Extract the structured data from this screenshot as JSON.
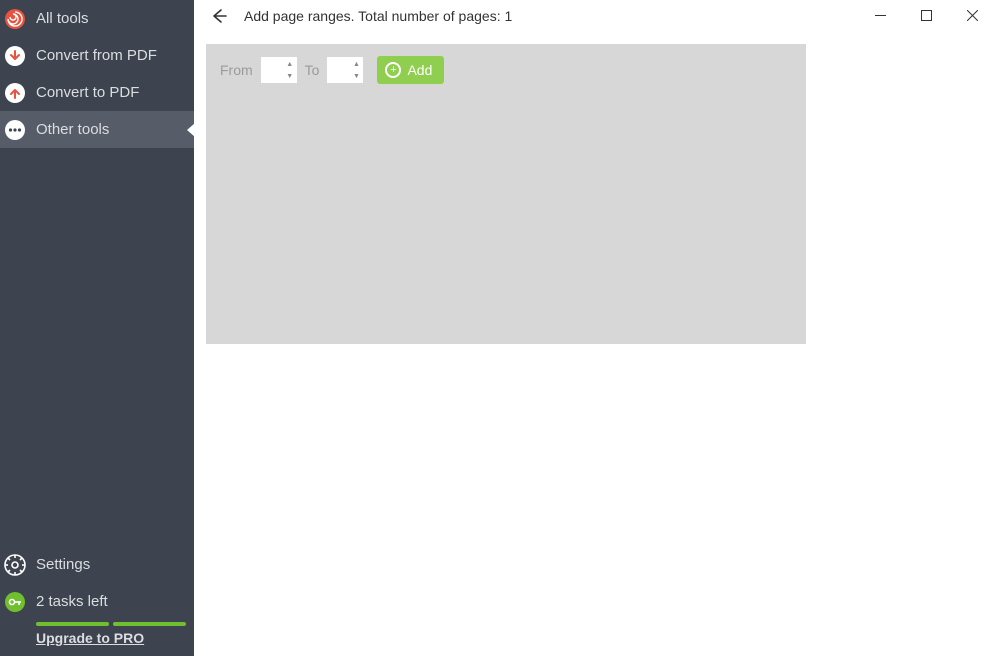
{
  "sidebar": {
    "items": [
      {
        "label": "All tools"
      },
      {
        "label": "Convert from PDF"
      },
      {
        "label": "Convert to PDF"
      },
      {
        "label": "Other tools"
      }
    ],
    "settings_label": "Settings",
    "tasks_left_label": "2 tasks left",
    "upgrade_label": "Upgrade to PRO"
  },
  "header": {
    "title": "Add page ranges. Total number of pages: 1"
  },
  "panel": {
    "from_label": "From",
    "to_label": "To",
    "add_label": "Add",
    "from_value": "",
    "to_value": ""
  }
}
